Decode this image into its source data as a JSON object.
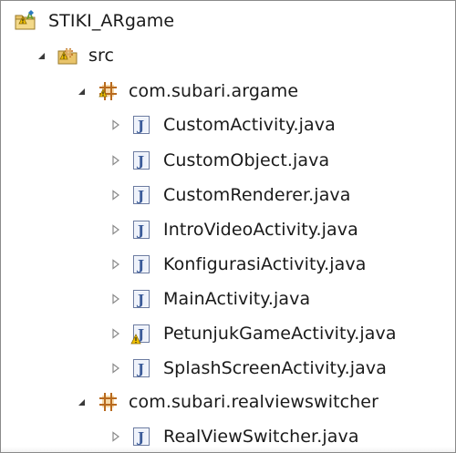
{
  "project": {
    "label": "STIKI_ARgame",
    "icon": "android-project-icon",
    "expanded": true
  },
  "src": {
    "label": "src",
    "icon": "source-folder-icon",
    "expanded": true
  },
  "packages": [
    {
      "label": "com.subari.argame",
      "icon": "package-icon",
      "expanded": true,
      "files": [
        {
          "label": "CustomActivity.java",
          "icon": "java-file-icon",
          "warning": false
        },
        {
          "label": "CustomObject.java",
          "icon": "java-file-icon",
          "warning": false
        },
        {
          "label": "CustomRenderer.java",
          "icon": "java-file-icon",
          "warning": false
        },
        {
          "label": "IntroVideoActivity.java",
          "icon": "java-file-icon",
          "warning": false
        },
        {
          "label": "KonfigurasiActivity.java",
          "icon": "java-file-icon",
          "warning": false
        },
        {
          "label": "MainActivity.java",
          "icon": "java-file-icon",
          "warning": false
        },
        {
          "label": "PetunjukGameActivity.java",
          "icon": "java-file-icon",
          "warning": true
        },
        {
          "label": "SplashScreenActivity.java",
          "icon": "java-file-icon",
          "warning": false
        }
      ]
    },
    {
      "label": "com.subari.realviewswitcher",
      "icon": "package-icon",
      "expanded": true,
      "files": [
        {
          "label": "RealViewSwitcher.java",
          "icon": "java-file-icon",
          "warning": false
        }
      ]
    }
  ],
  "colors": {
    "text": "#1a1a1a",
    "border": "#8a8a8a",
    "package": "#b86a1e",
    "java_j": "#3b5b99",
    "warning": "#e8b800"
  }
}
